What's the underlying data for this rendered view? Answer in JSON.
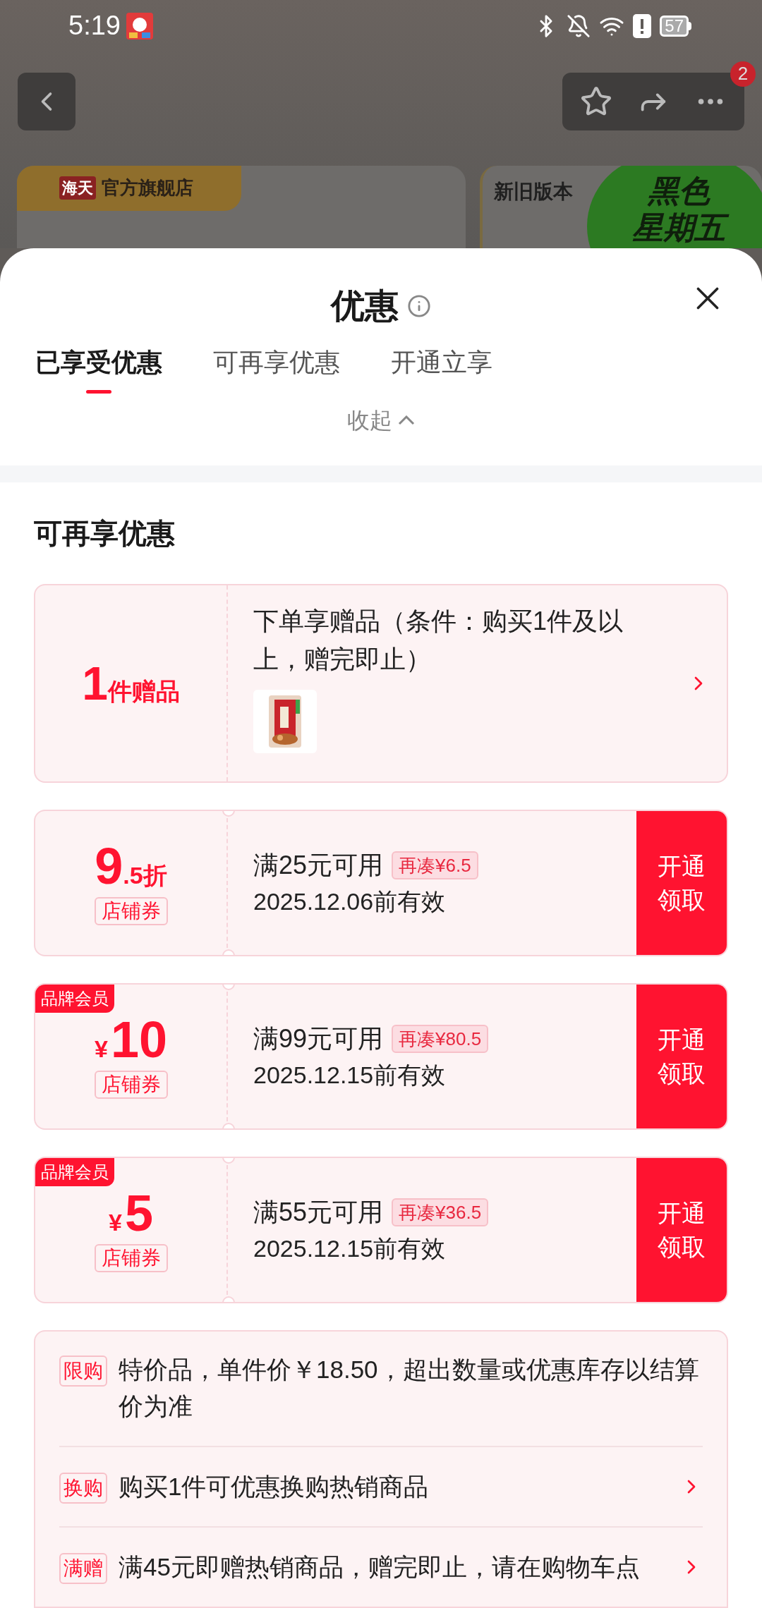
{
  "status_bar": {
    "time": "5:19",
    "battery": "57"
  },
  "nav": {
    "badge": "2"
  },
  "background_cards": {
    "store_logo": "海天",
    "store_name": "官方旗舰店",
    "version_label": "新旧版本",
    "promo_lines": [
      "黑色",
      "星期五"
    ]
  },
  "sheet": {
    "title": "优惠",
    "tabs": [
      {
        "label": "已享受优惠",
        "selected": true
      },
      {
        "label": "可再享优惠",
        "selected": false
      },
      {
        "label": "开通立享",
        "selected": false
      }
    ],
    "collapse": "收起",
    "section_title": "可再享优惠",
    "gift": {
      "count": "1",
      "unit": "件赠品",
      "text": "下单享赠品（条件：购买1件及以上，赠完即止）"
    },
    "coupons": [
      {
        "kind": "discount",
        "major": "9",
        "minor": ".5折",
        "tag": "店铺券",
        "condition": "满25元可用",
        "gap": "再凑¥6.5",
        "expiry": "2025.12.06前有效",
        "button": "开通领取"
      },
      {
        "kind": "amount",
        "badge": "品牌会员",
        "major": "10",
        "minor": "¥",
        "tag": "店铺券",
        "condition": "满99元可用",
        "gap": "再凑¥80.5",
        "expiry": "2025.12.15前有效",
        "button": "开通领取"
      },
      {
        "kind": "amount",
        "badge": "品牌会员",
        "major": "5",
        "minor": "¥",
        "tag": "店铺券",
        "condition": "满55元可用",
        "gap": "再凑¥36.5",
        "expiry": "2025.12.15前有效",
        "button": "开通领取"
      }
    ],
    "rules": [
      {
        "tag": "限购",
        "text": "特价品，单件价￥18.50，超出数量或优惠库存以结算价为准",
        "arrow": false
      },
      {
        "tag": "换购",
        "text": "购买1件可优惠换购热销商品",
        "arrow": true
      },
      {
        "tag": "满赠",
        "text": "满45元即赠热销商品，赠完即止，请在购物车点",
        "arrow": true
      }
    ]
  }
}
